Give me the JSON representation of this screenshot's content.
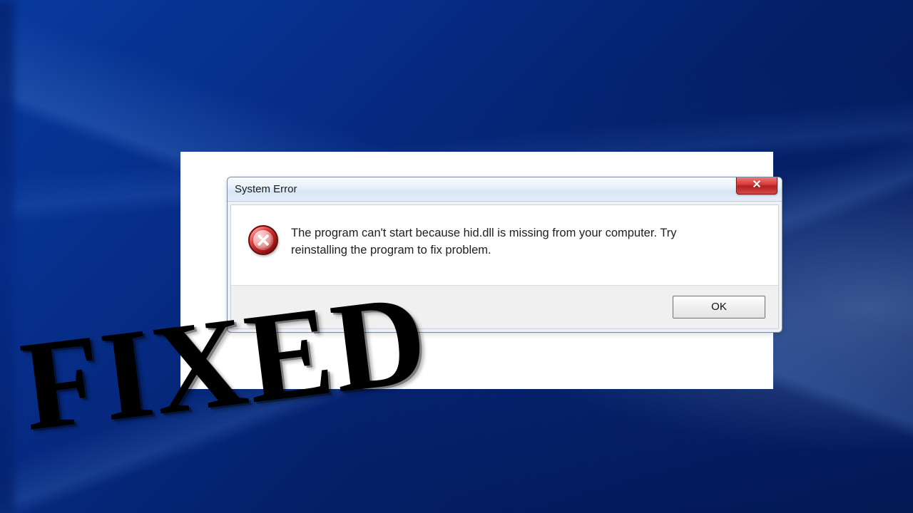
{
  "dialog": {
    "title": "System Error",
    "message": "The program can't start because hid.dll is missing from your computer. Try reinstalling the program to fix problem.",
    "ok_label": "OK",
    "close_aria": "Close"
  },
  "overlay": {
    "fixed_text": "FIXED"
  }
}
